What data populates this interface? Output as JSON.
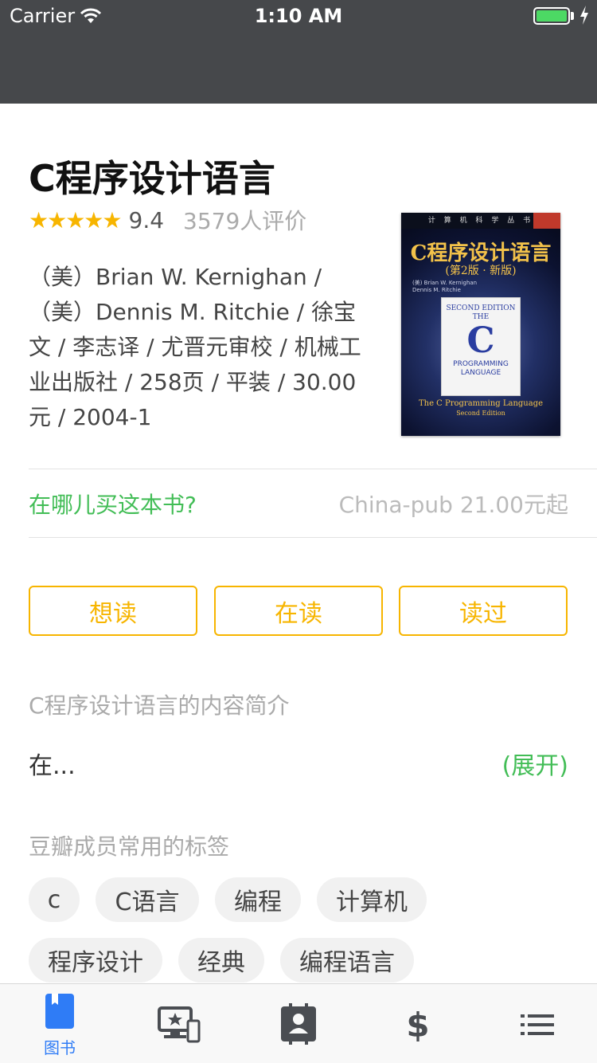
{
  "status_bar": {
    "carrier": "Carrier",
    "time": "1:10 AM",
    "battery_level": 1.0
  },
  "book": {
    "title": "C程序设计语言",
    "stars": "★★★★★",
    "rating": "9.4",
    "votes": "3579人评价",
    "meta": "（美）Brian W. Kernighan / （美）Dennis M. Ritchie / 徐宝文 / 李志译 / 尤晋元审校 / 机械工业出版社 / 258页 / 平装 / 30.00元 / 2004-1",
    "cover": {
      "series": "计 算 机 科 学 丛 书",
      "title": "C程序设计语言",
      "edition": "(第2版 · 新版)",
      "authors": "(美) Brian W. Kernighan\nDennis M. Ritchie",
      "inner_top": "SECOND EDITION\nTHE",
      "inner_letter": "C",
      "inner_bottom": "PROGRAMMING\nLANGUAGE",
      "english": "The C Programming Language",
      "english_edition": "Second Edition"
    }
  },
  "buy": {
    "label": "在哪儿买这本书?",
    "price": "China-pub 21.00元起"
  },
  "actions": {
    "want": "想读",
    "reading": "在读",
    "read": "读过"
  },
  "summary": {
    "heading": "C程序设计语言的内容简介",
    "text": "在...",
    "expand": "(展开)"
  },
  "tags": {
    "heading": "豆瓣成员常用的标签",
    "items": [
      "c",
      "C语言",
      "编程",
      "计算机",
      "程序设计",
      "经典",
      "编程语言"
    ]
  },
  "tabbar": {
    "items": [
      {
        "label": "图书",
        "icon": "book-icon",
        "active": true
      },
      {
        "label": "",
        "icon": "movie-icon",
        "active": false
      },
      {
        "label": "",
        "icon": "contacts-icon",
        "active": false
      },
      {
        "label": "",
        "icon": "dollar-icon",
        "active": false
      },
      {
        "label": "",
        "icon": "list-icon",
        "active": false
      }
    ]
  },
  "colors": {
    "accent_green": "#42bd56",
    "star": "#f7b500",
    "tab_active": "#2f7cf6",
    "tab_inactive": "#4a4d52"
  }
}
